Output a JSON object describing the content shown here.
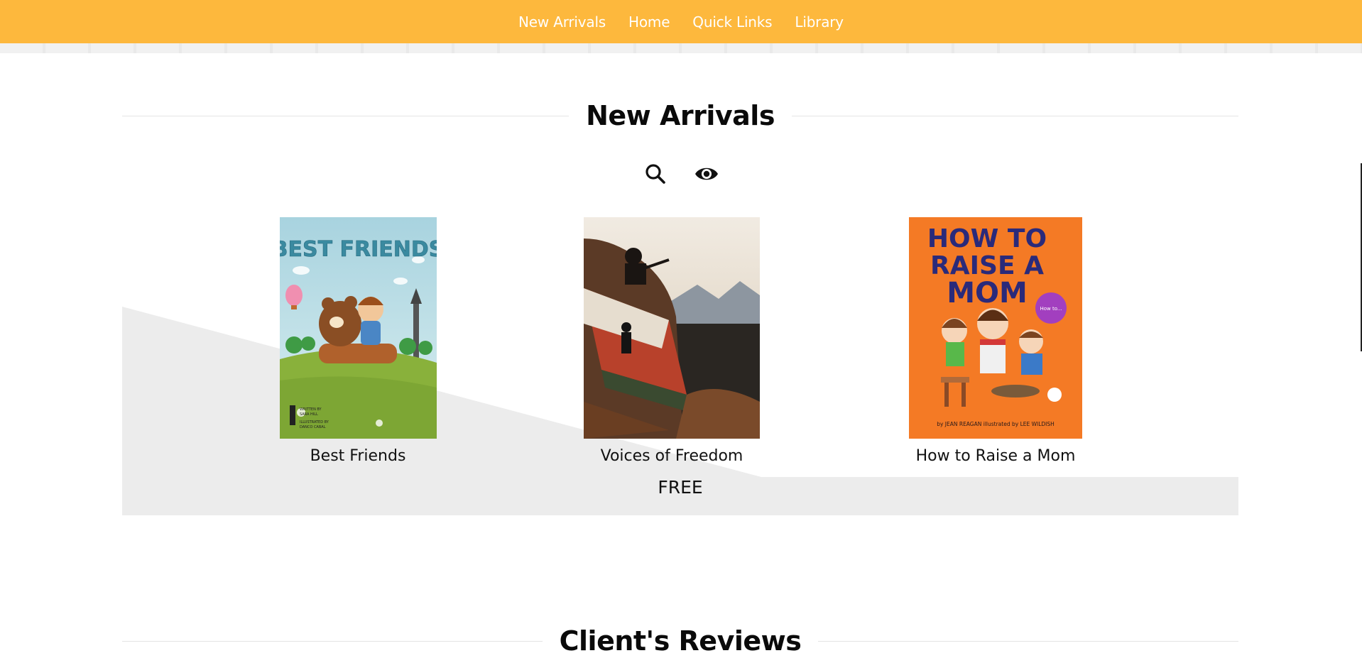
{
  "nav": {
    "items": [
      "New Arrivals",
      "Home",
      "Quick Links",
      "Library"
    ]
  },
  "new_arrivals": {
    "title": "New Arrivals",
    "icons": [
      "search-icon",
      "eye-icon"
    ],
    "books": [
      {
        "title": "Best Friends"
      },
      {
        "title": "Voices of Freedom"
      },
      {
        "title": "How to Raise a Mom"
      }
    ],
    "price_label": "FREE"
  },
  "cover_text": {
    "best_friends": {
      "title": "BEST FRIENDS",
      "credit1": "WRITTEN BY",
      "credit2": "SARA HILL",
      "credit3": "ILLUSTRATED BY",
      "credit4": "DANCO CABAL"
    },
    "how_to": {
      "title_line1": "HOW TO",
      "title_line2": "RAISE A",
      "title_line3": "MOM",
      "splat": "How to...",
      "authors": "by JEAN REAGAN   illustrated by LEE WILDISH"
    }
  },
  "reviews": {
    "title": "Client's Reviews"
  },
  "colors": {
    "nav_bg": "#fdb83d",
    "showcase_bg": "#ececec",
    "text": "#111111"
  }
}
